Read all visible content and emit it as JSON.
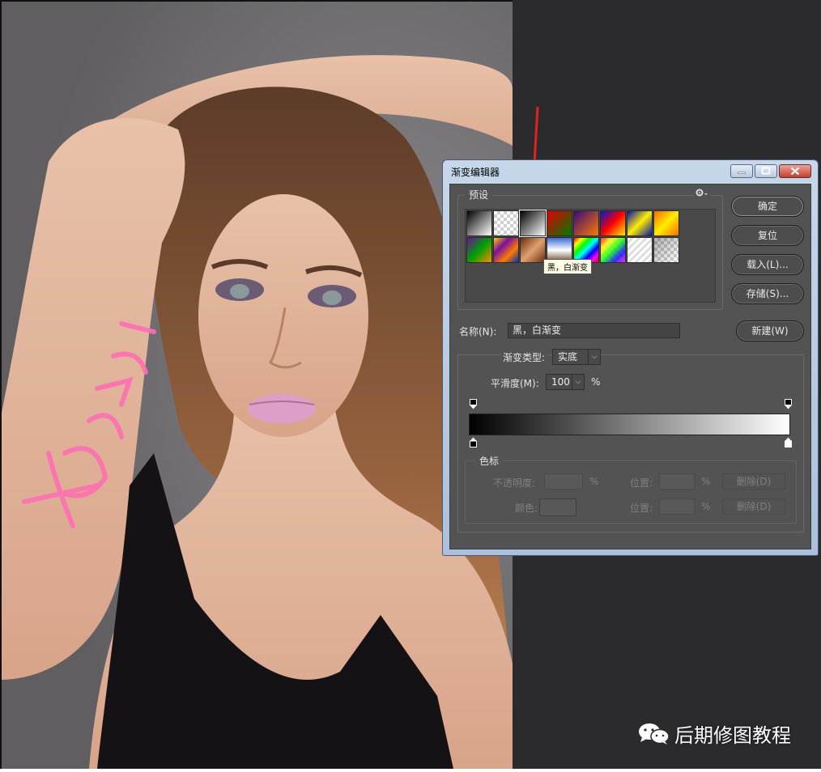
{
  "photo": {
    "description_icon": "portrait-photo"
  },
  "dialog": {
    "title": "渐变编辑器",
    "window_buttons": {
      "minimize": "minimize-icon",
      "maximize": "maximize-icon",
      "close": "close-icon"
    },
    "presets": {
      "legend": "预设",
      "menu_icon": "gear-icon",
      "tooltip": "黑，白渐变",
      "swatches_row1": [
        "foreground-to-background",
        "foreground-to-transparent",
        "black-white",
        "red-green",
        "violet-orange",
        "blue-red-yellow",
        "blue-yellow-blue",
        "orange-yellow-orange"
      ],
      "swatches_row2": [
        "violet-green-orange",
        "yellow-violet-orange-blue",
        "copper",
        "chrome",
        "spectrum",
        "transparent-rainbow",
        "transparent-stripes",
        "neutral-density"
      ]
    },
    "buttons": {
      "ok": "确定",
      "reset": "复位",
      "load": "载入(L)...",
      "save": "存储(S)...",
      "new": "新建(W)"
    },
    "name": {
      "label": "名称(N):",
      "value": "黑，白渐变"
    },
    "gradient_type": {
      "label": "渐变类型:",
      "value": "实底"
    },
    "smoothness": {
      "label": "平滑度(M):",
      "value": "100",
      "unit": "%"
    },
    "ramp": {
      "start_color": "#000000",
      "end_color": "#ffffff"
    },
    "stops": {
      "legend": "色标",
      "opacity_label": "不透明度:",
      "opacity_unit": "%",
      "position_label_1": "位置:",
      "position_unit_1": "%",
      "delete_label_1": "删除(D)",
      "color_label": "颜色:",
      "position_label_2": "位置:",
      "position_unit_2": "%",
      "delete_label_2": "删除(D)"
    }
  },
  "watermark": {
    "text": "后期修图教程",
    "icon": "wechat-icon"
  }
}
